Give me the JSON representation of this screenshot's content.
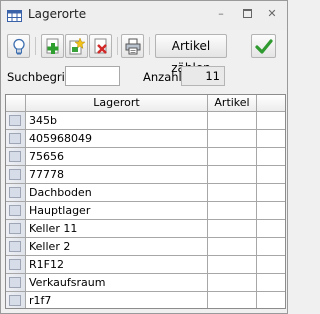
{
  "window": {
    "title": "Lagerorte",
    "controls": {
      "minimize": "–",
      "maximize": "☐",
      "close": "✕"
    }
  },
  "toolbar": {
    "buttons": [
      {
        "name": "hint",
        "icon": "lightbulb-icon"
      },
      {
        "name": "add",
        "icon": "green-plus-icon"
      },
      {
        "name": "edit",
        "icon": "edit-star-icon"
      },
      {
        "name": "delete",
        "icon": "red-delete-icon"
      },
      {
        "name": "print",
        "icon": "printer-icon"
      },
      {
        "name": "count_items",
        "label": "Artikel zählen"
      },
      {
        "name": "ok",
        "icon": "green-checkmark-icon"
      }
    ]
  },
  "filter": {
    "search_label": "Suchbegriff",
    "search_value": "",
    "count_label": "Anzahl",
    "count_value": "11"
  },
  "grid": {
    "columns": [
      "",
      "Lagerort",
      "Artikel",
      ""
    ],
    "rows": [
      {
        "lagerort": "345b",
        "artikel": ""
      },
      {
        "lagerort": "405968049",
        "artikel": ""
      },
      {
        "lagerort": "75656",
        "artikel": ""
      },
      {
        "lagerort": "77778",
        "artikel": ""
      },
      {
        "lagerort": "Dachboden",
        "artikel": ""
      },
      {
        "lagerort": "Hauptlager",
        "artikel": ""
      },
      {
        "lagerort": "Keller 11",
        "artikel": ""
      },
      {
        "lagerort": "Keller 2",
        "artikel": ""
      },
      {
        "lagerort": "R1F12",
        "artikel": ""
      },
      {
        "lagerort": "Verkaufsraum",
        "artikel": ""
      },
      {
        "lagerort": "r1f7",
        "artikel": ""
      }
    ]
  }
}
